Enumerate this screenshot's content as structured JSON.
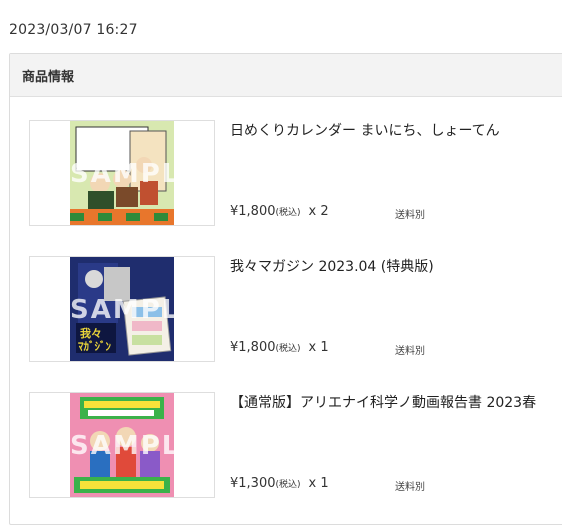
{
  "timestamp": "2023/03/07 16:27",
  "panel": {
    "title": "商品情報"
  },
  "watermark": "SAMPLE",
  "items": [
    {
      "title": "日めくりカレンダー まいにち、しょーてん",
      "price": "¥1,800",
      "tax_label": "(税込)",
      "quantity": "x 2",
      "shipping": "送料別",
      "cover_colors": {
        "bg": "#d8e8b0",
        "accent": "#e8762c",
        "dark": "#2f4f2a"
      }
    },
    {
      "title": "我々マガジン 2023.04 (特典版)",
      "price": "¥1,800",
      "tax_label": "(税込)",
      "quantity": "x 1",
      "shipping": "送料別",
      "cover_colors": {
        "bg": "#1f2d6e",
        "accent": "#e8d33a",
        "dark": "#0e1640"
      }
    },
    {
      "title": "【通常版】アリエナイ科学ノ動画報告書 2023春",
      "price": "¥1,300",
      "tax_label": "(税込)",
      "quantity": "x 1",
      "shipping": "送料別",
      "cover_colors": {
        "bg": "#ef8fb2",
        "accent": "#3bb24a",
        "dark": "#2a6fc0"
      }
    }
  ]
}
